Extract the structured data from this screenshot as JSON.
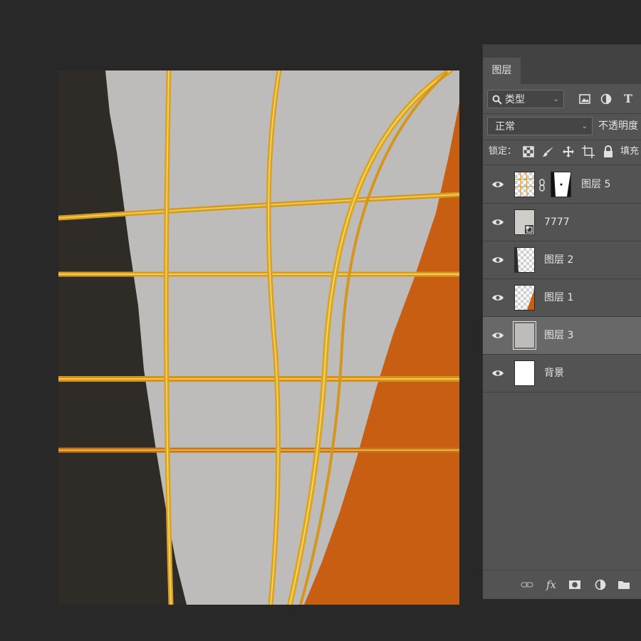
{
  "panel": {
    "tab_label": "图层",
    "filter_select": "类型",
    "filter_icons": [
      "image-filter-icon",
      "adjustment-filter-icon",
      "type-filter-icon"
    ],
    "type_filter_glyph": "T",
    "blend_mode": "正常",
    "opacity_label": "不透明度",
    "lock_label": "锁定：",
    "lock_icons": [
      "lock-transparent-icon",
      "lock-paint-icon",
      "lock-move-icon",
      "lock-artboard-icon",
      "lock-all-icon"
    ],
    "fill_label": "填充",
    "layers": [
      {
        "name": "图层 5",
        "visible": true,
        "has_mask": true,
        "selected": false
      },
      {
        "name": "7777",
        "visible": true,
        "smart_object": true,
        "selected": false
      },
      {
        "name": "图层 2",
        "visible": true,
        "selected": false
      },
      {
        "name": "图层 1",
        "visible": true,
        "selected": false
      },
      {
        "name": "图层 3",
        "visible": true,
        "selected": true
      },
      {
        "name": "背景",
        "visible": true,
        "selected": false
      }
    ],
    "footer_icons": [
      "link-layers-icon",
      "fx-icon",
      "add-mask-icon",
      "adjustment-layer-icon",
      "new-group-icon"
    ],
    "fx_label": "fx"
  },
  "colors": {
    "app_background": "#282828",
    "panel_background": "#535353",
    "selected_layer": "#686868",
    "canvas_gray": "#bdbcba",
    "canvas_dark": "#2f2c28",
    "canvas_orange": "#c85e12",
    "gold": "#e2b22a"
  }
}
